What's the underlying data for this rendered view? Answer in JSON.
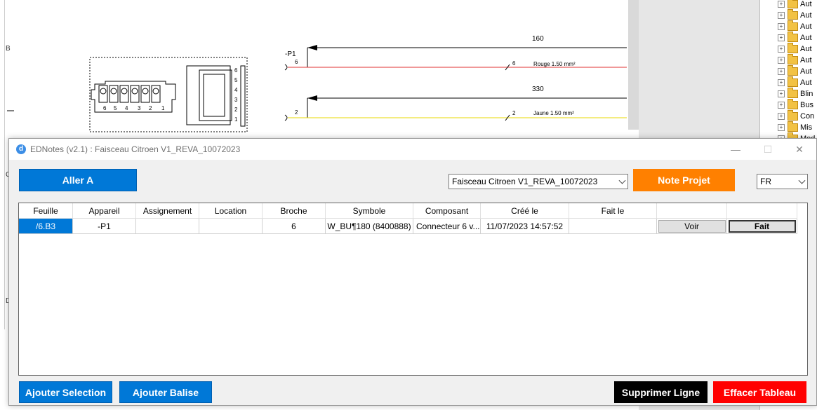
{
  "schematic": {
    "row_label_b": "B",
    "connector_pins_left": [
      "6",
      "5",
      "4",
      "3",
      "2",
      "1"
    ],
    "connector_pins_right": [
      "6",
      "5",
      "4",
      "3",
      "2",
      "1"
    ],
    "device_label": "-P1",
    "wire1": {
      "length": "160",
      "pin_start": "6",
      "pin_mid": "6",
      "label": "Rouge  1.50 mm²",
      "color": "#e03030"
    },
    "wire2": {
      "length": "330",
      "pin_start": "2",
      "pin_mid": "2",
      "label": "Jaune  1.50 mm²",
      "color": "#e8d800"
    },
    "side_mark_c": "C",
    "side_mark_d": "D"
  },
  "tree": {
    "items": [
      "Aut",
      "Aut",
      "Aut",
      "Aut",
      "Aut",
      "Aut",
      "Aut",
      "Aut",
      "Blin",
      "Bus",
      "Con",
      "Mis",
      "Mod"
    ]
  },
  "window": {
    "title": "EDNotes (v2.1) : Faisceau Citroen V1_REVA_10072023",
    "app_icon_letter": "d",
    "minimize_glyph": "—",
    "maximize_glyph": "☐",
    "close_glyph": "✕"
  },
  "toolbar": {
    "aller_a": "Aller A",
    "project_select": "Faisceau Citroen V1_REVA_10072023",
    "note_projet": "Note Projet",
    "lang_select": "FR"
  },
  "table": {
    "headers": [
      "Feuille",
      "Appareil",
      "Assignement",
      "Location",
      "Broche",
      "Symbole",
      "Composant",
      "Créé le",
      "Fait le",
      "",
      ""
    ],
    "rows": [
      {
        "feuille": "/6.B3",
        "appareil": "-P1",
        "assignement": "",
        "location": "",
        "broche": "6",
        "symbole": "W_BU¶180 (8400888)",
        "composant": "Connecteur 6 v...",
        "cree_le": "11/07/2023 14:57:52",
        "fait_le": "",
        "voir": "Voir",
        "fait": "Fait"
      }
    ]
  },
  "footer": {
    "ajouter_selection": "Ajouter Selection",
    "ajouter_balise": "Ajouter Balise",
    "supprimer_ligne": "Supprimer Ligne",
    "effacer_tableau": "Effacer Tableau"
  },
  "colors": {
    "blue_button": "#0078d7",
    "orange_button": "#ff8000",
    "black_button": "#000000",
    "red_button": "#ff0000",
    "selection": "#0078d7"
  }
}
